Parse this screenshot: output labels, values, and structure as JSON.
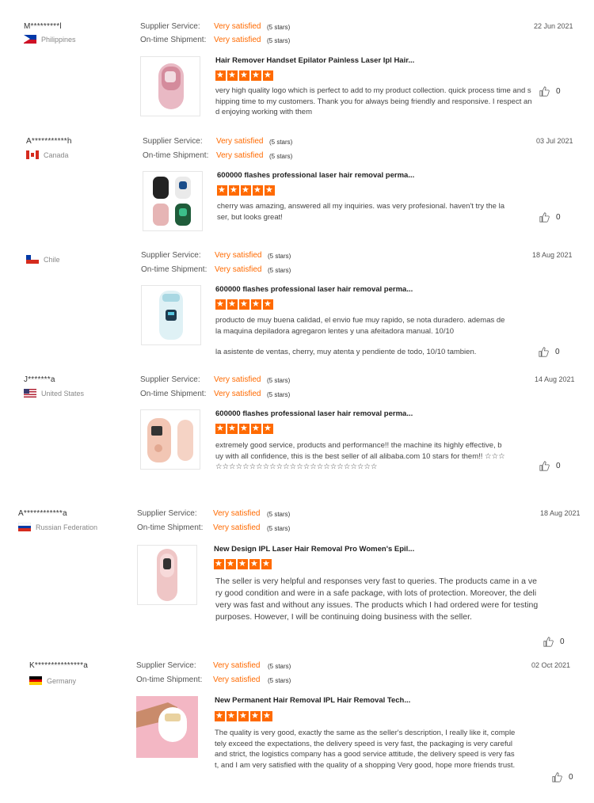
{
  "labels": {
    "supplier_service": "Supplier Service:",
    "shipment": "On-time Shipment:",
    "satisfied": "Very satisfied",
    "stars": "(5 stars)"
  },
  "reviews": [
    {
      "user": "M*********l",
      "country": "Philippines",
      "flag": "ph",
      "date": "22 Jun 2021",
      "product": "Hair Remover Handset Epilator Painless Laser Ipl Hair...",
      "text": "very high quality logo which is perfect to add to my product collection. quick process time and shipping time to my customers. Thank you for always being friendly and responsive. I respect and enjoying working with them",
      "text2": "",
      "likes": "0",
      "thumb_icon": "pink-epilator-icon"
    },
    {
      "user": "A***********h",
      "country": "Canada",
      "flag": "ca",
      "date": "03 Jul 2021",
      "product": "600000 flashes professional laser hair removal perma...",
      "text": "cherry was amazing, answered all my inquiries. was very profesional. haven't try the laser, but looks great!",
      "text2": "",
      "likes": "0",
      "thumb_icon": "four-epilators-icon"
    },
    {
      "user": "",
      "country": "Chile",
      "flag": "cl",
      "date": "18 Aug 2021",
      "product": "600000 flashes professional laser hair removal perma...",
      "text": "producto de muy buena calidad, el envio fue muy rapido, se nota duradero. ademas de la maquina depiladora agregaron lentes y una afeitadora manual. 10/10",
      "text2": "la asistente de ventas, cherry, muy atenta y pendiente de todo, 10/10 tambien.",
      "likes": "0",
      "thumb_icon": "blue-epilator-icon"
    },
    {
      "user": "J*******a",
      "country": "United States",
      "flag": "us",
      "date": "14 Aug 2021",
      "product": "600000 flashes professional laser hair removal perma...",
      "text": "extremely good service, products and performance!! the machine its highly effective, buy with all confidence, this is the best seller of all alibaba.com 10 stars for them!! ☆☆☆☆☆☆☆☆☆☆☆☆☆☆☆☆☆☆☆☆☆☆☆☆☆☆☆",
      "text2": "",
      "likes": "0",
      "thumb_icon": "peach-epilator-icon"
    },
    {
      "user": "A************a",
      "country": "Russian Federation",
      "flag": "ru",
      "date": "18 Aug 2021",
      "product": "New Design IPL Laser Hair Removal Pro Women's Epil...",
      "text": "The seller is very helpful and responses very fast to queries. The products came in a very good condition and were in a safe package, with lots of protection. Moreover, the delivery was fast and without any issues. The products which I had ordered were for testing purposes. However, I will be continuing doing business with the seller.",
      "text2": "",
      "likes": "0",
      "thumb_icon": "pink-device-icon"
    },
    {
      "user": "K***************a",
      "country": "Germany",
      "flag": "de",
      "date": "02 Oct 2021",
      "product": "New Permanent Hair Removal IPL Hair Removal Tech...",
      "text": "The quality is very good, exactly the same as the seller's description, I really like it, completely exceed the expectations, the delivery speed is very fast, the packaging is very careful and strict, the logistics company has a good service attitude, the delivery speed is very fast, and I am very satisfied with the quality of a shopping Very good, hope more friends trust.",
      "text2": "",
      "likes": "0",
      "thumb_icon": "hand-device-icon"
    }
  ]
}
